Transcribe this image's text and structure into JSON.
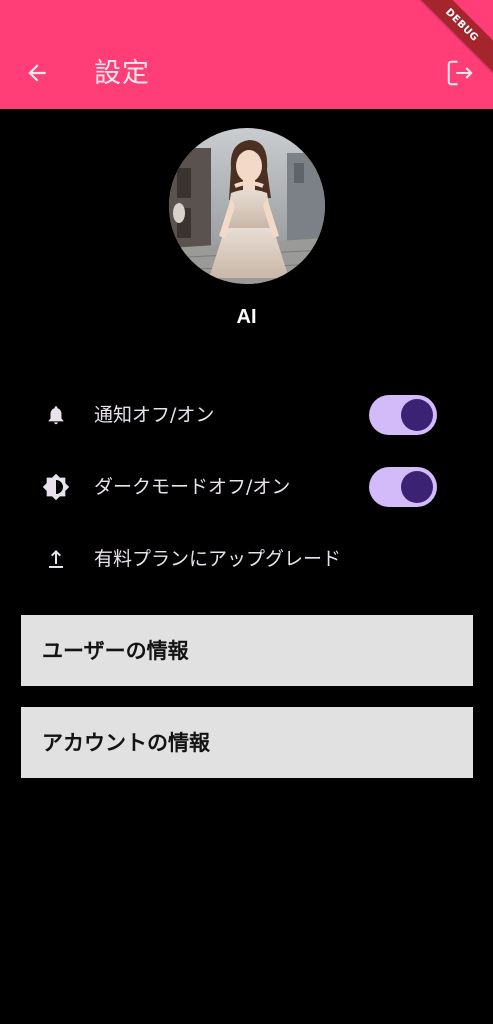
{
  "appbar": {
    "title": "設定",
    "background": "#ff3d77",
    "back_icon": "arrow-left-icon",
    "logout_icon": "logout-icon",
    "debug_banner": "DEBUG"
  },
  "profile": {
    "name": "AI",
    "avatar": "profile-photo"
  },
  "settings": {
    "notifications": {
      "label": "通知オフ/オン",
      "icon": "bell-icon",
      "enabled": true
    },
    "dark_mode": {
      "label": "ダークモードオフ/オン",
      "icon": "brightness-icon",
      "enabled": true
    },
    "upgrade": {
      "label": "有料プランにアップグレード",
      "icon": "upload-icon"
    }
  },
  "cards": {
    "user_info": "ユーザーの情報",
    "account_info": "アカウントの情報"
  },
  "colors": {
    "switch_track": "#d2bbf8",
    "switch_knob": "#3b2273",
    "card_bg": "#e1e1e1"
  }
}
